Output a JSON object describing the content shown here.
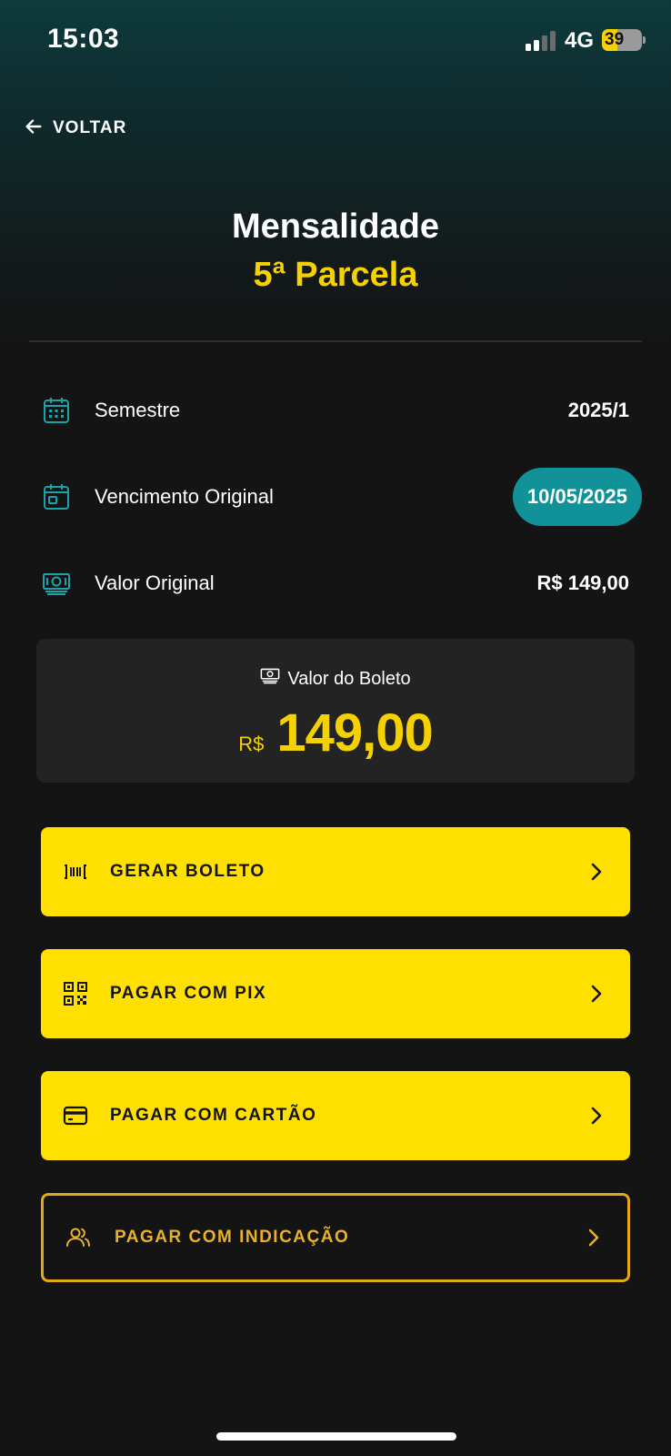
{
  "status_bar": {
    "time": "15:03",
    "network": "4G",
    "battery": "39",
    "battery_level": 0.39
  },
  "nav": {
    "back_label": "VOLTAR"
  },
  "header": {
    "title": "Mensalidade",
    "subtitle": "5ª Parcela"
  },
  "details": {
    "semester": {
      "icon": "calendar-grid-icon",
      "label": "Semestre",
      "value": "2025/1"
    },
    "due_date": {
      "icon": "calendar-icon",
      "label": "Vencimento Original",
      "value": "10/05/2025"
    },
    "original_value": {
      "icon": "money-icon",
      "label": "Valor Original",
      "value": "R$ 149,00"
    }
  },
  "boleto_total": {
    "caption": "Valor do Boleto",
    "currency": "R$",
    "amount": "149,00"
  },
  "actions": [
    {
      "label": "GERAR BOLETO",
      "icon": "barcode-icon"
    },
    {
      "label": "PAGAR COM PIX",
      "icon": "qr-code-icon"
    },
    {
      "label": "PAGAR COM CARTÃO",
      "icon": "credit-card-icon"
    },
    {
      "label": "PAGAR COM INDICAÇÃO",
      "icon": "users-icon"
    }
  ],
  "colors": {
    "accent_yellow": "#ffe000",
    "teal": "#119198",
    "outline_gold": "#e3a916",
    "background": "#141414"
  }
}
